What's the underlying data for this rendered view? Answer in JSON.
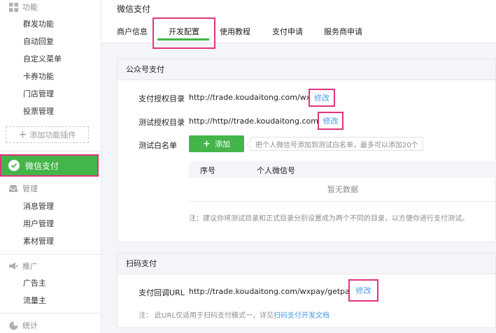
{
  "sidebar": {
    "group_features": "功能",
    "features": [
      "群发功能",
      "自动回复",
      "自定义菜单",
      "卡券功能",
      "门店管理",
      "投票管理"
    ],
    "add_plugin": "添加功能插件",
    "active_item": "微信支付",
    "group_manage": "管理",
    "manage_items": [
      "消息管理",
      "用户管理",
      "素材管理"
    ],
    "group_promo": "推广",
    "promo_items": [
      "广告主",
      "流量主"
    ],
    "group_stats": "统计"
  },
  "header": {
    "title": "微信支付",
    "tabs": [
      {
        "label": "商户信息",
        "active": false
      },
      {
        "label": "开发配置",
        "active": true
      },
      {
        "label": "使用教程",
        "active": false
      },
      {
        "label": "支付申请",
        "active": false
      },
      {
        "label": "服务商申请",
        "active": false
      }
    ]
  },
  "public_pay": {
    "title": "公众号支付",
    "auth_dir_label": "支付授权目录",
    "auth_dir_value": "http://trade.koudaitong.com/wxpay/",
    "test_dir_label": "测试授权目录",
    "test_dir_value": "http://http//trade.koudaitong.com/test/",
    "edit_label": "修改",
    "whitelist_label": "测试白名单",
    "add_button": "添加",
    "add_hint": "把个人微信号添加到测试白名单，最多可以添加20个",
    "table_headers": [
      "序号",
      "个人微信号"
    ],
    "table_empty": "暂无数据",
    "note": "注：建议你将测试目录和正式目录分别设置成为两个不同的目录，以方便你进行支付测试。"
  },
  "scan_pay": {
    "title": "扫码支付",
    "callback_label": "支付回调URL",
    "callback_value": "http://trade.koudaitong.com/wxpay/getpackage",
    "edit_label": "修改",
    "note_prefix": "注： 此URL仅适用于扫码支付模式一，详见",
    "note_link": "扫码支付开发文档"
  },
  "colors": {
    "accent": "#44b549",
    "highlight": "#e0337d",
    "link": "#459ae9"
  }
}
